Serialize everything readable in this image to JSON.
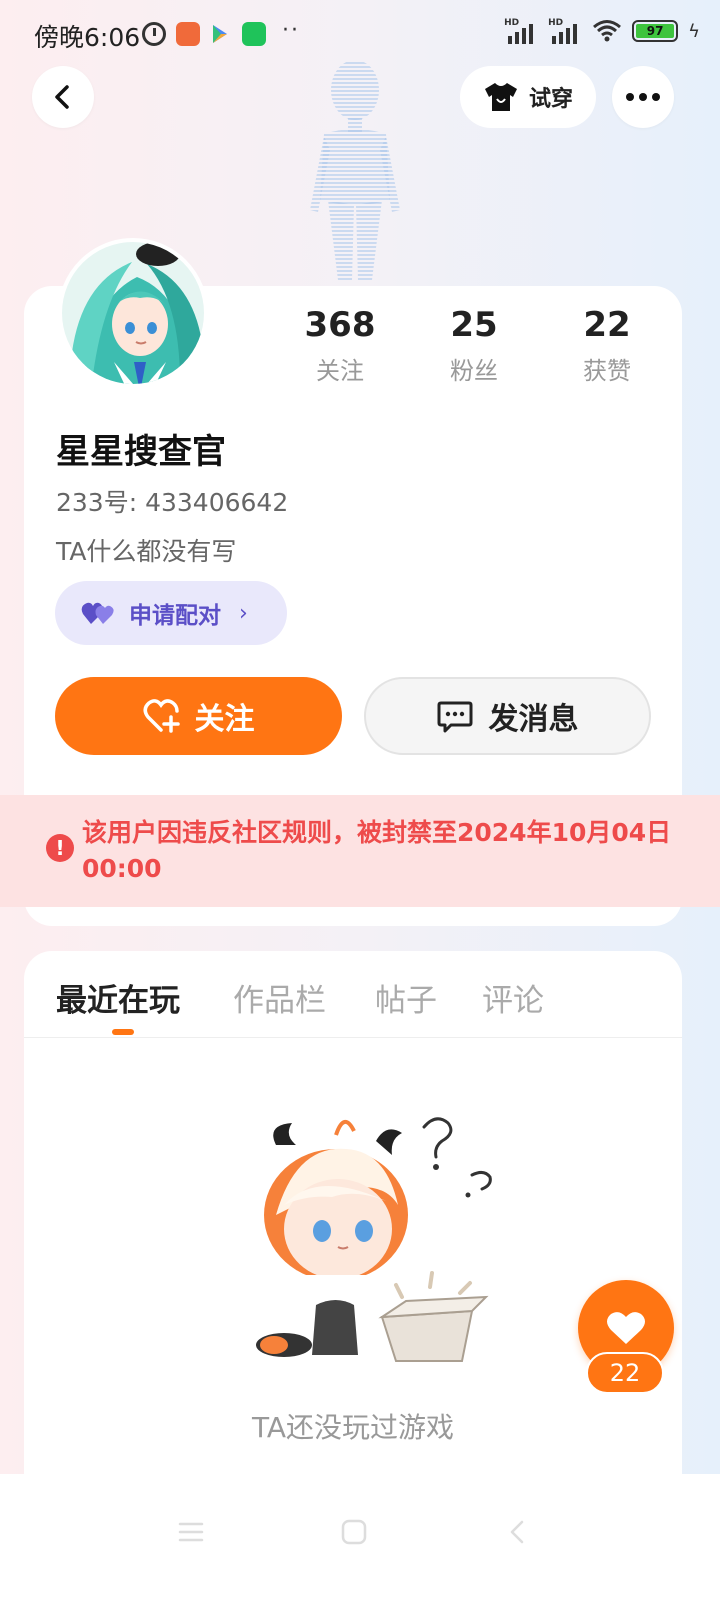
{
  "status_bar": {
    "time": "傍晚6:06",
    "battery": "97"
  },
  "header": {
    "try_on_label": "试穿"
  },
  "profile": {
    "nickname": "星星搜查官",
    "uid": "233号: 433406642",
    "bio": "TA什么都没有写",
    "stats": [
      {
        "value": "368",
        "label": "关注"
      },
      {
        "value": "25",
        "label": "粉丝"
      },
      {
        "value": "22",
        "label": "获赞"
      }
    ],
    "pair_label": "申请配对",
    "follow_label": "关注",
    "message_label": "发消息",
    "ban_notice": "该用户因违反社区规则，被封禁至2024年10月04日 00:00"
  },
  "tabs": [
    {
      "label": "最近在玩",
      "active": true
    },
    {
      "label": "作品栏",
      "active": false
    },
    {
      "label": "帖子",
      "active": false
    },
    {
      "label": "评论",
      "active": false
    }
  ],
  "empty_state": {
    "text": "TA还没玩过游戏"
  },
  "like_fab": {
    "count": "22"
  },
  "colors": {
    "accent": "#ff7513",
    "ban": "#ee4b4b",
    "pair": "#5b4fc7"
  },
  "icons": {
    "back": "chevron-left-icon",
    "try_on": "tshirt-icon",
    "more": "more-dots-icon",
    "pair": "hearts-icon",
    "follow": "heart-plus-icon",
    "message": "chat-bubble-icon",
    "ban": "alert-icon",
    "like": "heart-icon"
  }
}
